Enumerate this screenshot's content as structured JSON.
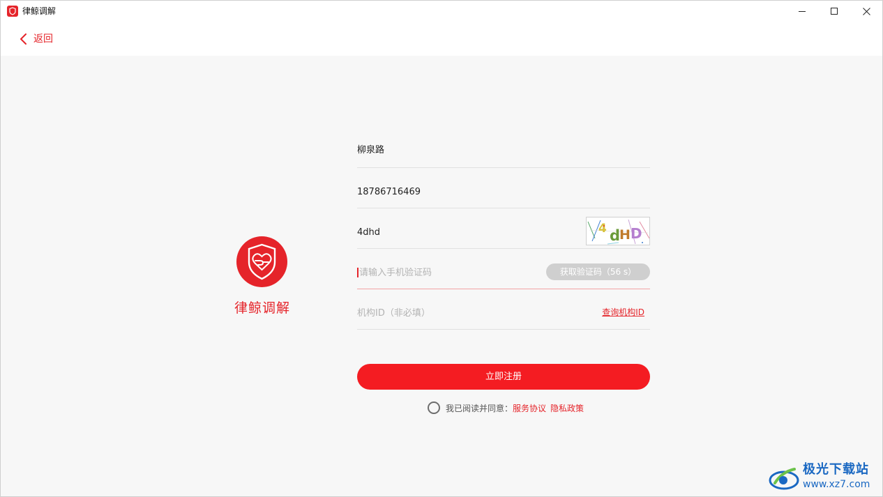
{
  "window": {
    "title": "律鲸调解",
    "controls": {
      "minimize": "minimize-icon",
      "maximize": "maximize-icon",
      "close": "close-icon"
    }
  },
  "header": {
    "back_label": "返回",
    "back_icon": "chevron-left-icon"
  },
  "brand": {
    "name": "律鲸调解",
    "logo_icon": "shield-handshake-icon",
    "color": "#e5242a"
  },
  "form": {
    "name_value": "柳泉路",
    "phone_value": "18786716469",
    "captcha_value": "4dhd",
    "captcha_image_text": "4dHD",
    "sms_code_placeholder": "请输入手机验证码",
    "get_code_label": "获取验证码（56 s）",
    "org_id_placeholder": "机构ID（非必填）",
    "query_org_id_label": "查询机构ID",
    "submit_label": "立即注册"
  },
  "agreement": {
    "text": "我已阅读并同意：",
    "terms_link": "服务协议",
    "privacy_link": "隐私政策",
    "checked": false
  },
  "watermark": {
    "title": "极光下载站",
    "url": "www.xz7.com"
  },
  "colors": {
    "accent": "#e5242a",
    "button": "#f41c22",
    "disabled": "#cfcfcf"
  }
}
